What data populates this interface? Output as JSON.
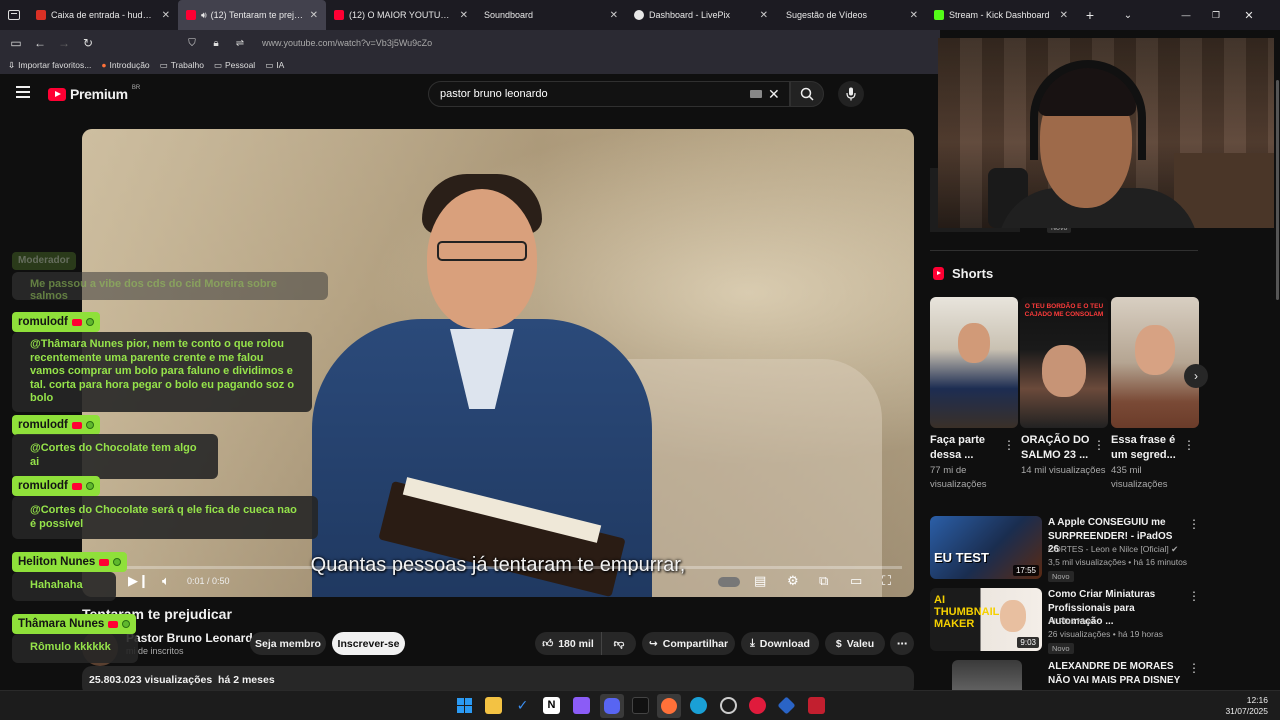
{
  "browser": {
    "tabs": [
      {
        "title": "Caixa de entrada - hudsonfabio",
        "color": "#d93025"
      },
      {
        "title": "(12) Tentaram te prejudicar",
        "color": "#ff0033",
        "active": true
      },
      {
        "title": "(12) O MAIOR YOUTUBER DO P",
        "color": "#ff0033"
      },
      {
        "title": "Soundboard",
        "color": "#1c1b22"
      },
      {
        "title": "Dashboard - LivePix",
        "color": "#e8e8e8"
      },
      {
        "title": "Sugestão de Vídeos",
        "color": "#1c1b22"
      },
      {
        "title": "Stream - Kick Dashboard",
        "color": "#53fc18"
      }
    ],
    "url": "www.youtube.com/watch?v=Vb3j5Wu9cZo",
    "bookmarks": [
      "Importar favoritos...",
      "Introdução",
      "Trabalho",
      "Pessoal",
      "IA"
    ]
  },
  "youtube": {
    "logo": "Premium",
    "region": "BR",
    "search_query": "pastor bruno leonardo"
  },
  "player": {
    "subtitle": "Quantas pessoas já tentaram te empurrar,",
    "time": "0:01 / 0:50",
    "progress": 0.02
  },
  "video": {
    "title": "Tentaram te prejudicar",
    "channel": "Pastor Bruno Leonardo",
    "subs": "mi de inscritos",
    "member_label": "Seja membro",
    "subscribe_label": "Inscrever-se",
    "likes": "180 mil",
    "share_label": "Compartilhar",
    "download_label": "Download",
    "valeu_label": "Valeu",
    "views": "25.803.023 visualizações",
    "age": "há 2 meses"
  },
  "chat": {
    "faded_name": "Moderador",
    "faded_msg": "Me passou a vibe dos cds do cid Moreira sobre salmos",
    "messages": [
      {
        "name": "romulodf",
        "text": "@Thâmara Nunes pior, nem te conto o que rolou recentemente uma parente crente e me falou vamos comprar um bolo para faluno e dividimos e tal. corta para hora pegar o bolo eu pagando soz o bolo"
      },
      {
        "name": "romulodf",
        "text": "@Cortes do Chocolate tem algo ai"
      },
      {
        "name": "romulodf",
        "text": "@Cortes do Chocolate será q ele fica de cueca nao é possível"
      },
      {
        "name": "Heliton Nunes",
        "text": "Hahahaha"
      },
      {
        "name": "Thâmara Nunes",
        "text": "Rômulo kkkkkk"
      }
    ]
  },
  "sidebar": {
    "novo_top": "Novo",
    "shorts_title": "Shorts",
    "shorts": [
      {
        "title": "Faça parte dessa ...",
        "views": "77 mi de visualizações"
      },
      {
        "title": "ORAÇÃO DO SALMO 23 ...",
        "views": "14 mil visualizações",
        "overlay": "O TEU BORDÃO E O TEU CAJADO ME CONSOLAM"
      },
      {
        "title": "Essa frase é um segred...",
        "views": "435 mil visualizações"
      }
    ],
    "recommendations": [
      {
        "title": "A Apple CONSEGUIU me SURPREENDER! - iPadOS 26",
        "channel": "CORTES - Leon e Nilce [Oficial]",
        "meta": "3,5 mil visualizações • há 16 minutos",
        "badge": "Novo",
        "duration": "17:55",
        "thumb_text": "EU TEST"
      },
      {
        "title": "Como Criar Miniaturas Profissionais para Automação ...",
        "channel": "AI Plus More",
        "meta": "26 visualizações • há 19 horas",
        "badge": "Novo",
        "duration": "9:03",
        "thumb_text": "AI THUMBNAIL MAKER"
      },
      {
        "title": "ALEXANDRE DE MORAES NÃO VAI MAIS PRA DISNEY",
        "channel": "",
        "meta": "",
        "badge": "",
        "duration": ""
      }
    ]
  },
  "taskbar": {
    "time": "12:16",
    "date": "31/07/2025"
  }
}
